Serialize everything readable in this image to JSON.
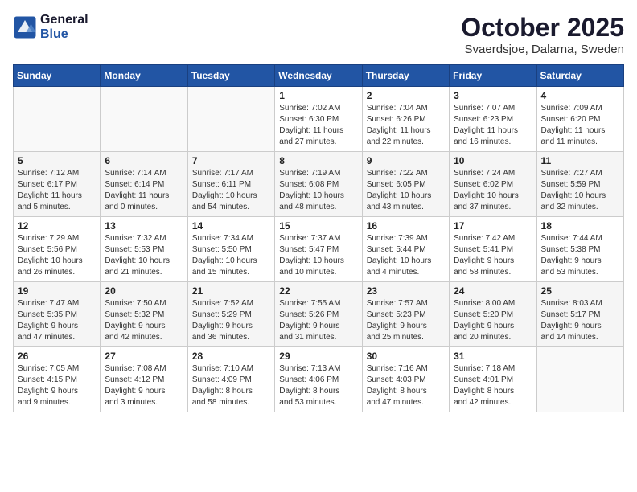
{
  "logo": {
    "general": "General",
    "blue": "Blue"
  },
  "title": {
    "month_year": "October 2025",
    "location": "Svaerdsjoe, Dalarna, Sweden"
  },
  "weekdays": [
    "Sunday",
    "Monday",
    "Tuesday",
    "Wednesday",
    "Thursday",
    "Friday",
    "Saturday"
  ],
  "weeks": [
    [
      {
        "day": "",
        "info": ""
      },
      {
        "day": "",
        "info": ""
      },
      {
        "day": "",
        "info": ""
      },
      {
        "day": "1",
        "info": "Sunrise: 7:02 AM\nSunset: 6:30 PM\nDaylight: 11 hours\nand 27 minutes."
      },
      {
        "day": "2",
        "info": "Sunrise: 7:04 AM\nSunset: 6:26 PM\nDaylight: 11 hours\nand 22 minutes."
      },
      {
        "day": "3",
        "info": "Sunrise: 7:07 AM\nSunset: 6:23 PM\nDaylight: 11 hours\nand 16 minutes."
      },
      {
        "day": "4",
        "info": "Sunrise: 7:09 AM\nSunset: 6:20 PM\nDaylight: 11 hours\nand 11 minutes."
      }
    ],
    [
      {
        "day": "5",
        "info": "Sunrise: 7:12 AM\nSunset: 6:17 PM\nDaylight: 11 hours\nand 5 minutes."
      },
      {
        "day": "6",
        "info": "Sunrise: 7:14 AM\nSunset: 6:14 PM\nDaylight: 11 hours\nand 0 minutes."
      },
      {
        "day": "7",
        "info": "Sunrise: 7:17 AM\nSunset: 6:11 PM\nDaylight: 10 hours\nand 54 minutes."
      },
      {
        "day": "8",
        "info": "Sunrise: 7:19 AM\nSunset: 6:08 PM\nDaylight: 10 hours\nand 48 minutes."
      },
      {
        "day": "9",
        "info": "Sunrise: 7:22 AM\nSunset: 6:05 PM\nDaylight: 10 hours\nand 43 minutes."
      },
      {
        "day": "10",
        "info": "Sunrise: 7:24 AM\nSunset: 6:02 PM\nDaylight: 10 hours\nand 37 minutes."
      },
      {
        "day": "11",
        "info": "Sunrise: 7:27 AM\nSunset: 5:59 PM\nDaylight: 10 hours\nand 32 minutes."
      }
    ],
    [
      {
        "day": "12",
        "info": "Sunrise: 7:29 AM\nSunset: 5:56 PM\nDaylight: 10 hours\nand 26 minutes."
      },
      {
        "day": "13",
        "info": "Sunrise: 7:32 AM\nSunset: 5:53 PM\nDaylight: 10 hours\nand 21 minutes."
      },
      {
        "day": "14",
        "info": "Sunrise: 7:34 AM\nSunset: 5:50 PM\nDaylight: 10 hours\nand 15 minutes."
      },
      {
        "day": "15",
        "info": "Sunrise: 7:37 AM\nSunset: 5:47 PM\nDaylight: 10 hours\nand 10 minutes."
      },
      {
        "day": "16",
        "info": "Sunrise: 7:39 AM\nSunset: 5:44 PM\nDaylight: 10 hours\nand 4 minutes."
      },
      {
        "day": "17",
        "info": "Sunrise: 7:42 AM\nSunset: 5:41 PM\nDaylight: 9 hours\nand 58 minutes."
      },
      {
        "day": "18",
        "info": "Sunrise: 7:44 AM\nSunset: 5:38 PM\nDaylight: 9 hours\nand 53 minutes."
      }
    ],
    [
      {
        "day": "19",
        "info": "Sunrise: 7:47 AM\nSunset: 5:35 PM\nDaylight: 9 hours\nand 47 minutes."
      },
      {
        "day": "20",
        "info": "Sunrise: 7:50 AM\nSunset: 5:32 PM\nDaylight: 9 hours\nand 42 minutes."
      },
      {
        "day": "21",
        "info": "Sunrise: 7:52 AM\nSunset: 5:29 PM\nDaylight: 9 hours\nand 36 minutes."
      },
      {
        "day": "22",
        "info": "Sunrise: 7:55 AM\nSunset: 5:26 PM\nDaylight: 9 hours\nand 31 minutes."
      },
      {
        "day": "23",
        "info": "Sunrise: 7:57 AM\nSunset: 5:23 PM\nDaylight: 9 hours\nand 25 minutes."
      },
      {
        "day": "24",
        "info": "Sunrise: 8:00 AM\nSunset: 5:20 PM\nDaylight: 9 hours\nand 20 minutes."
      },
      {
        "day": "25",
        "info": "Sunrise: 8:03 AM\nSunset: 5:17 PM\nDaylight: 9 hours\nand 14 minutes."
      }
    ],
    [
      {
        "day": "26",
        "info": "Sunrise: 7:05 AM\nSunset: 4:15 PM\nDaylight: 9 hours\nand 9 minutes."
      },
      {
        "day": "27",
        "info": "Sunrise: 7:08 AM\nSunset: 4:12 PM\nDaylight: 9 hours\nand 3 minutes."
      },
      {
        "day": "28",
        "info": "Sunrise: 7:10 AM\nSunset: 4:09 PM\nDaylight: 8 hours\nand 58 minutes."
      },
      {
        "day": "29",
        "info": "Sunrise: 7:13 AM\nSunset: 4:06 PM\nDaylight: 8 hours\nand 53 minutes."
      },
      {
        "day": "30",
        "info": "Sunrise: 7:16 AM\nSunset: 4:03 PM\nDaylight: 8 hours\nand 47 minutes."
      },
      {
        "day": "31",
        "info": "Sunrise: 7:18 AM\nSunset: 4:01 PM\nDaylight: 8 hours\nand 42 minutes."
      },
      {
        "day": "",
        "info": ""
      }
    ]
  ]
}
